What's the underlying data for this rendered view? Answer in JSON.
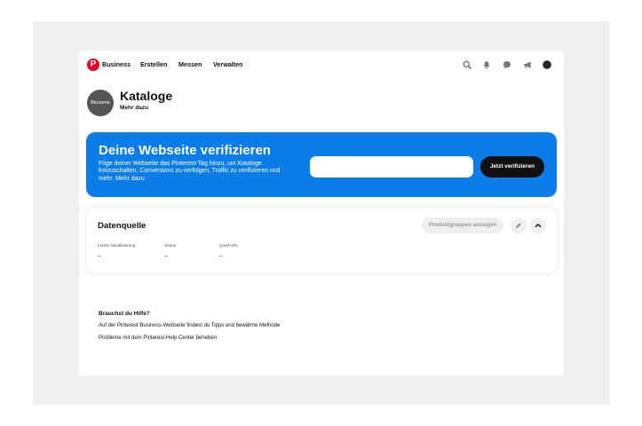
{
  "nav": {
    "brand": "Business",
    "items": [
      "Erstellen",
      "Messen",
      "Verwalten"
    ],
    "icons": [
      "search-icon",
      "bell-icon",
      "chat-icon",
      "megaphone-icon",
      "avatar"
    ]
  },
  "header": {
    "profile_label": "Bluxome",
    "title": "Kataloge",
    "subtitle": "Mehr dazu"
  },
  "banner": {
    "title": "Deine Webseite verifizieren",
    "text": "Füge deiner Webseite das Pinterest-Tag hinzu, um Kataloge freizuschalten, Conversions zu verfolgen, Traffic zu verifizieren und mehr. Mehr dazu",
    "input_value": "",
    "button_label": "Jetzt verifizieren",
    "color": "#0a7de8"
  },
  "datasource": {
    "title": "Datenquelle",
    "button_label": "Produktgruppen anzeigen",
    "columns": [
      {
        "label": "Letzte Aktualisierung",
        "value": "–"
      },
      {
        "label": "Status",
        "value": "–"
      },
      {
        "label": "Quell-URL",
        "value": "–"
      }
    ]
  },
  "help": {
    "title": "Brauchst du Hilfe?",
    "lines": [
      "Auf der Pinterest Business-Webseite findest du Tipps und bewährte Methode",
      "Probleme mit dem Pinterest-Help Center beheben"
    ]
  }
}
